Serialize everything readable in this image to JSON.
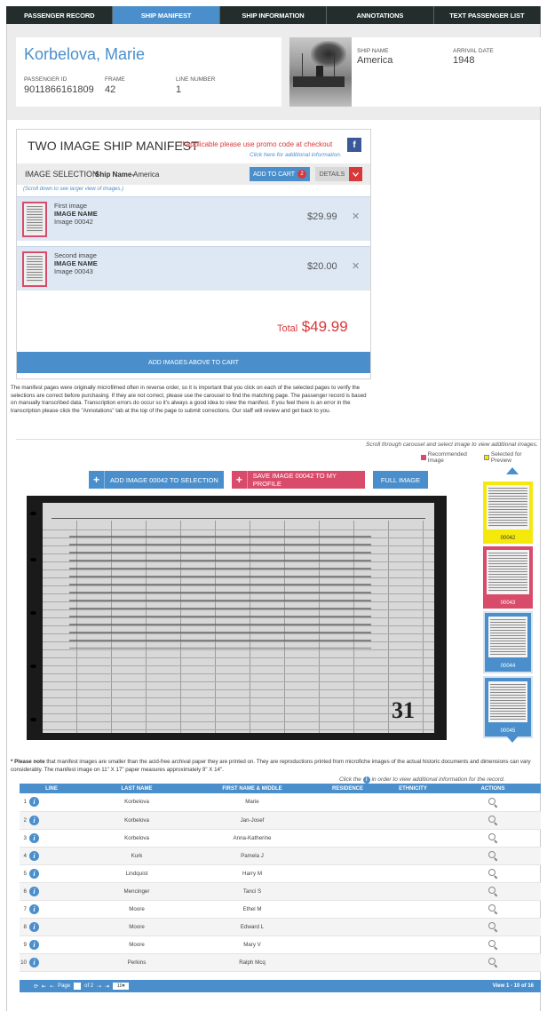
{
  "tabs": [
    {
      "label": "PASSENGER RECORD",
      "active": false
    },
    {
      "label": "SHIP MANIFEST",
      "active": true
    },
    {
      "label": "SHIP INFORMATION",
      "active": false
    },
    {
      "label": "ANNOTATIONS",
      "active": false
    },
    {
      "label": "TEXT PASSENGER LIST",
      "active": false
    }
  ],
  "passenger": {
    "name": "Korbelova, Marie",
    "id_label": "PASSENGER ID",
    "id_value": "9011866161809",
    "frame_label": "FRAME",
    "frame_value": "42",
    "line_label": "LINE NUMBER",
    "line_value": "1"
  },
  "ship": {
    "name_label": "SHIP NAME",
    "name_value": "America",
    "arrival_label": "ARRIVAL DATE",
    "arrival_value": "1948"
  },
  "cart": {
    "title": "TWO IMAGE SHIP MANIFEST",
    "promo": "If applicable please use promo code at checkout",
    "click_here": "Click here for additional information.",
    "facebook": "f",
    "image_selection": "IMAGE SELECTION",
    "ship_name_label": "Ship Name-",
    "ship_name_value": "America",
    "add_to_cart": "ADD TO CART",
    "cart_count": "2",
    "details": "DETAILS",
    "scroll_note": "(Scroll down to see larger view of images.)",
    "items": [
      {
        "title": "First image",
        "name_label": "IMAGE NAME",
        "image": "Image 00042",
        "price": "$29.99"
      },
      {
        "title": "Second image",
        "name_label": "IMAGE NAME",
        "image": "Image 00043",
        "price": "$20.00"
      }
    ],
    "total_label": "Total",
    "total_value": "$49.99",
    "add_images_button": "ADD IMAGES ABOVE TO CART"
  },
  "description": "The manifest pages were originally microfilmed often in reverse order, so it is important that you click on each of the selected pages to verify the selections are correct before purchasing. If they are not correct, please use the carousel to find the matching page. The passenger record is based on manually transcribed data. Transcription errors do occur so it's always a good idea to view the manifest. If you feel there is an error in the transcription please click the \"Annotations\" tab at the top of the page to submit corrections. Our staff will review and get back to you.",
  "viewer": {
    "scroll_hint": "Scroll through carousel and select image to view additional images.",
    "legend_recommended": "Recommended Image",
    "legend_selected": "Selected for Preview",
    "add_button": "ADD IMAGE 00042 TO SELECTION",
    "save_button": "SAVE IMAGE 00042 TO MY PROFILE",
    "full_button": "FULL IMAGE",
    "page_number": "31",
    "thumbnails": [
      {
        "label": "00042",
        "state": "selected",
        "color": "#f5e90c"
      },
      {
        "label": "00043",
        "state": "recommended",
        "color": "#d94b6a"
      },
      {
        "label": "00044",
        "state": "normal",
        "color": "#4a8fcc"
      },
      {
        "label": "00045",
        "state": "normal",
        "color": "#4a8fcc"
      }
    ]
  },
  "please_note": {
    "bold": "* Please note",
    "text": " that manifest images are smaller than the acid-free archival paper they are printed on. They are reproductions printed from microfiche images of the actual historic documents and dimensions can vary considerably. The manifest image on 11\" X 17\" paper measures approximately 9\" X 14\"."
  },
  "table_hint": {
    "before": "Click the",
    "after": "in order to view additional information for the record."
  },
  "table": {
    "headers": [
      "LINE",
      "LAST NAME",
      "FIRST NAME & MIDDLE",
      "RESIDENCE",
      "ETHNICITY",
      "ACTIONS"
    ],
    "rows": [
      {
        "line": "1",
        "last": "Korbelova",
        "first": "Marie"
      },
      {
        "line": "2",
        "last": "Korbelova",
        "first": "Jan-Josef"
      },
      {
        "line": "3",
        "last": "Korbelova",
        "first": "Anna-Katherine"
      },
      {
        "line": "4",
        "last": "Kurk",
        "first": "Pamela J"
      },
      {
        "line": "5",
        "last": "Lindquist",
        "first": "Harry M"
      },
      {
        "line": "6",
        "last": "Mencinger",
        "first": "Tanci S"
      },
      {
        "line": "7",
        "last": "Moore",
        "first": "Ethel M"
      },
      {
        "line": "8",
        "last": "Moore",
        "first": "Edward L"
      },
      {
        "line": "9",
        "last": "Moore",
        "first": "Mary V"
      },
      {
        "line": "10",
        "last": "Perkins",
        "first": "Ralph Mcq"
      }
    ]
  },
  "pager": {
    "page_label": "Page",
    "of_label": "of 2",
    "page_size": "10",
    "view_text": "View 1 - 10 of 16"
  },
  "colors": {
    "accent": "#4a8fcc",
    "danger": "#d94b6a",
    "tabbar": "#232d2c",
    "highlight": "#f5e90c"
  }
}
